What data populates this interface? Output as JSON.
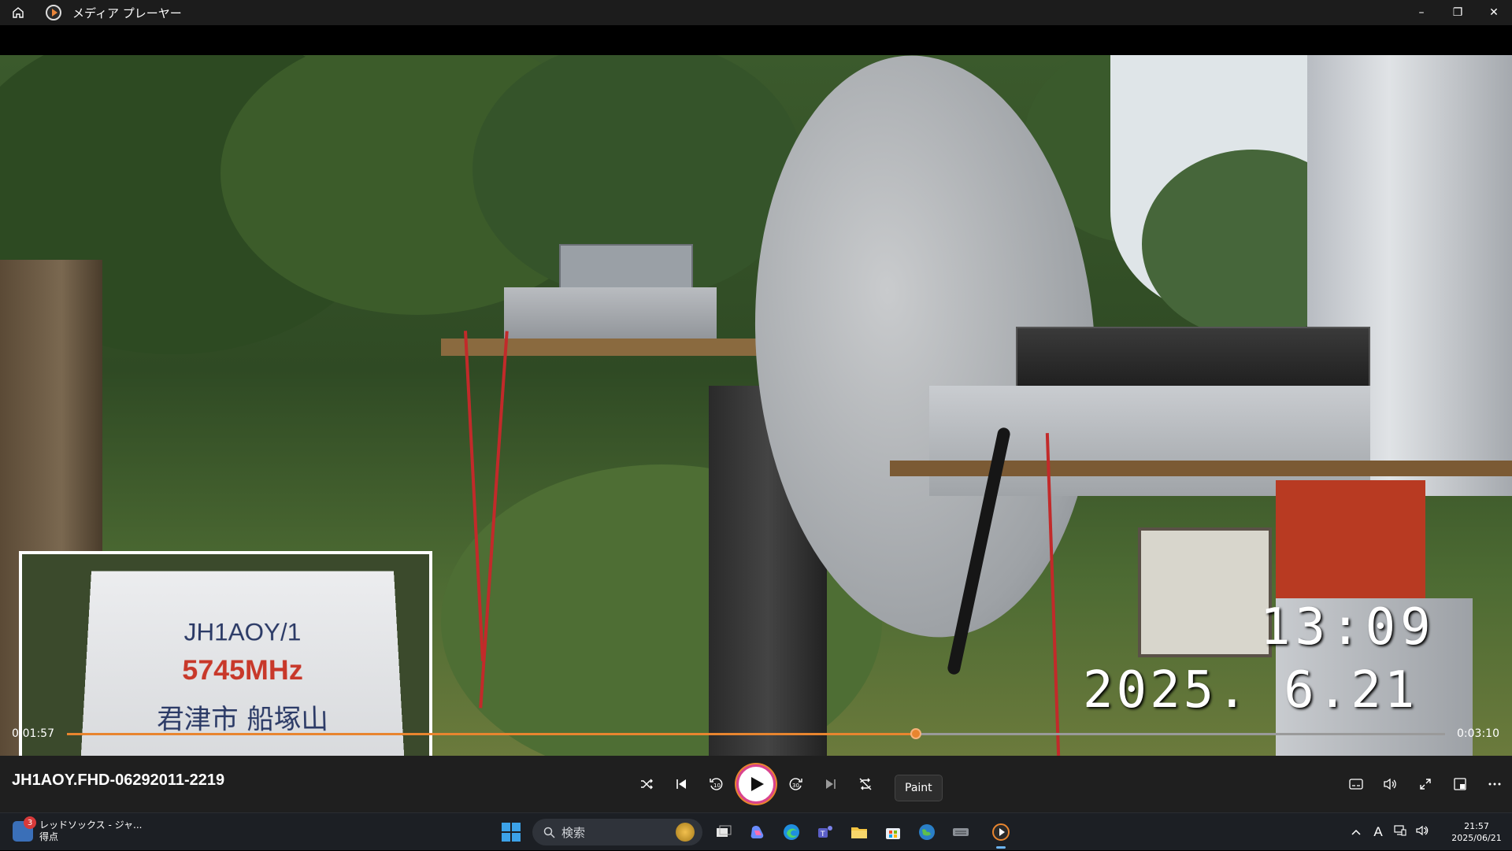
{
  "window": {
    "title": "メディア プレーヤー",
    "controls": {
      "minimize": "–",
      "restore": "❐",
      "close": "✕"
    }
  },
  "video": {
    "overlay_time": "13:09",
    "overlay_date": "2025. 6.21",
    "pip_sign": {
      "line1": "JH1AOY/1",
      "line2": "5745MHz",
      "line3": "君津市 船塚山"
    }
  },
  "player": {
    "current_time": "0:01:57",
    "duration": "0:03:10",
    "progress": 0.6158,
    "media_title": "JH1AOY.FHD-06292011-2219",
    "tooltip": "Paint",
    "accent_color": "#e8852f"
  },
  "taskbar": {
    "widget": {
      "badge": "3",
      "line1": "レッドソックス - ジャ...",
      "line2": "得点"
    },
    "search_placeholder": "検索",
    "apps": [
      "task-view-icon",
      "copilot-icon",
      "edge-icon",
      "teams-icon",
      "file-explorer-icon",
      "store-icon",
      "globe-app-icon",
      "keyboard-app-icon",
      "media-player-icon"
    ],
    "tray": {
      "ime": "A"
    },
    "clock": {
      "time": "21:57",
      "date": "2025/06/21"
    }
  }
}
